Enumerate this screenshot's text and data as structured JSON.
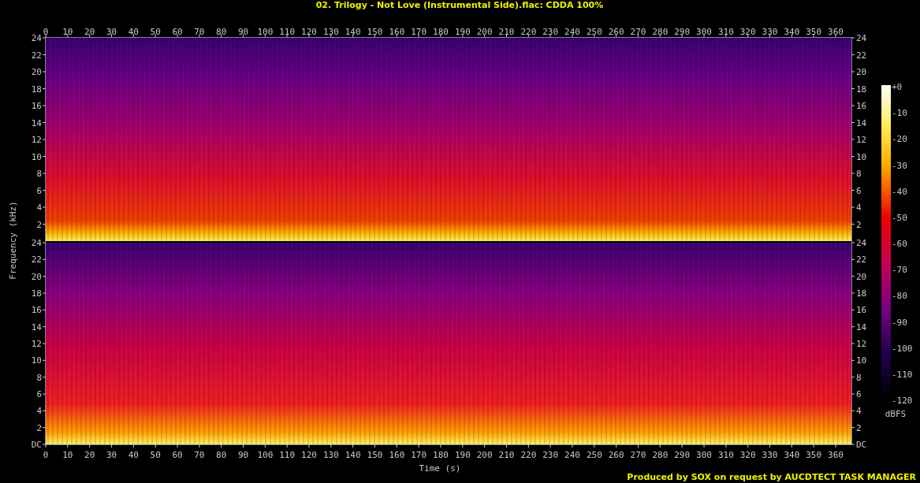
{
  "title": "02. Trilogy - Not Love (Instrumental Side).flac: CDDA 100%",
  "time_axis": {
    "label": "Time (s)",
    "top_ticks": [
      "0",
      "10",
      "20",
      "30",
      "40",
      "50",
      "60",
      "70",
      "80",
      "90",
      "100",
      "110",
      "120",
      "130",
      "140",
      "150",
      "160",
      "170",
      "180",
      "190",
      "200",
      "210",
      "220",
      "230",
      "240",
      "250",
      "260",
      "270",
      "280",
      "290",
      "300",
      "310",
      "320",
      "330",
      "340",
      "350",
      "360"
    ],
    "bottom_ticks": [
      "0",
      "10",
      "20",
      "30",
      "40",
      "50",
      "60",
      "70",
      "80",
      "90",
      "100",
      "110",
      "120",
      "130",
      "140",
      "150",
      "160",
      "170",
      "180",
      "190",
      "200",
      "210",
      "220",
      "230",
      "240",
      "250",
      "260",
      "270",
      "280",
      "290",
      "300",
      "310",
      "320",
      "330",
      "340",
      "350",
      "360"
    ]
  },
  "frequency_axis": {
    "label": "Frequency (kHz)"
  },
  "channels": [
    {
      "left_ticks": [
        "24",
        "22",
        "20",
        "18",
        "16",
        "14",
        "12",
        "10",
        "8",
        "6",
        "4",
        "2"
      ],
      "right_ticks": [
        "24",
        "22",
        "20",
        "18",
        "16",
        "14",
        "12",
        "10",
        "8",
        "6",
        "4",
        "2"
      ]
    },
    {
      "left_ticks": [
        "24",
        "22",
        "20",
        "18",
        "16",
        "14",
        "12",
        "10",
        "8",
        "6",
        "4",
        "2",
        "DC"
      ],
      "right_ticks": [
        "24",
        "22",
        "20",
        "18",
        "16",
        "14",
        "12",
        "10",
        "8",
        "6",
        "4",
        "2",
        "DC"
      ]
    }
  ],
  "color_scale": {
    "ticks": [
      "+0",
      "-10",
      "-20",
      "-30",
      "-40",
      "-50",
      "-60",
      "-70",
      "-80",
      "-90",
      "-100",
      "-110",
      "-120"
    ],
    "unit": "dBFS"
  },
  "footer": "Produced by SOX on request by AUCDTECT TASK MANAGER"
}
